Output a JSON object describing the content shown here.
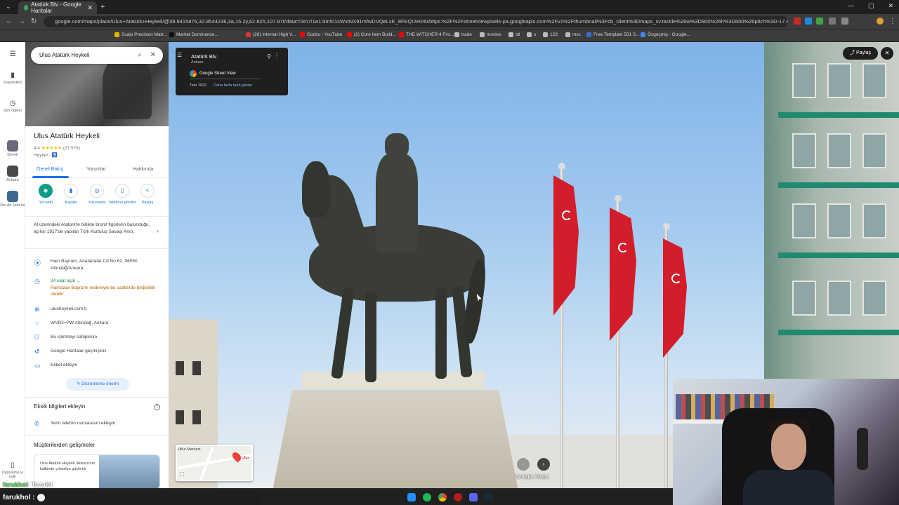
{
  "browser": {
    "tab_title": "Atatürk Blv - Google Haritalar",
    "url": "google.com/maps/place/Ulus+Atatürk+Heykeli/@39.9415876,32.8544236,3a,15.2y,62.82h,107.87t/data=!3m7!1e1!3m5!1sWvINX91mfwDVQeLxK_8FEQ!2e0!6shttps:%2F%2Fstreetviewpixels-pa.googleapis.com%2Fv1%2Fthumbnail%3Fcb_client%3Dmaps_sv.tactile%26w%3D900%26h%3D600%26pitch%3D-17.86526409588829...",
    "bookmarks": [
      "Scalp Precision Matr...",
      "Market Dominance...",
      "(28) Internal High V...",
      "Godzu - YouTube",
      "(2) Core Item Build...",
      "THE WITCHER 4 Firs...",
      "trade",
      "movies",
      "stl",
      "s",
      "123",
      "msc",
      "Free Template 551 S...",
      "Özgeçmiş - Google..."
    ]
  },
  "rail": {
    "saved": "Kaydedildi",
    "recent": "Son öğeler",
    "recent_items": [
      "Develi",
      "Ankara",
      "Rio de Janeiro"
    ],
    "app": "Uygulama yı indir"
  },
  "search": {
    "value": "Ulus Atatürk Heykeli"
  },
  "place": {
    "title": "Ulus Atatürk Heykeli",
    "rating": "4,4",
    "stars": "★★★★★",
    "reviews": "(27.576)",
    "category": "Heykel · ♿",
    "tabs": [
      "Genel Bakış",
      "Yorumlar",
      "Hakkında"
    ],
    "actions": [
      {
        "label": "Yol tarifi",
        "icon": "◆"
      },
      {
        "label": "Kaydet",
        "icon": "▮"
      },
      {
        "label": "Yakınında",
        "icon": "◎"
      },
      {
        "label": "Telefona gönder",
        "icon": "▯"
      },
      {
        "label": "Paylaş",
        "icon": "<"
      }
    ],
    "description": "At üzerindeki Atatürk'le birlikte bronz figürlerin bulunduğu, açılışı 1927'de yapılan Türk Kurtuluş Savaşı Anıtı.",
    "address": "Hacı Bayram, Anafartalar Cd No:62, 06050 Altındağ/Ankara",
    "hours_status": "24 saat açık",
    "hours_warning": "Ramazan Bayramı nedeniyle bu saatlerde değişiklik olabilir",
    "website": "ulusheykeli.com.tr",
    "plus_code": "WVR3+PW Altındağ, Ankara",
    "claim": "Bu işletmeyi sahiplenin",
    "history": "Google Haritalar geçmişiniz",
    "label": "Etiket ekleyin",
    "suggest_edit": "Düzenleme önerin",
    "missing_title": "Eksik bilgileri ekleyin",
    "add_phone": "Yerin telefon numarasını ekleyin",
    "highlights_title": "Müşterilerden gelişmeler",
    "card_text": "Ulus Atatürk Heykeli, Ankara'nın kalbinde yükselen güçlü bir"
  },
  "streetview": {
    "street": "Atatürk Blv",
    "city": "Ankara",
    "source": "Google Street View",
    "date": "Tem 2020",
    "more_dates": "Daha fazla tarih göster",
    "share": "Paylaş",
    "minimap_label": "ültür Merkezi",
    "minimap_place": "Ulus",
    "brand": "Google Maps"
  },
  "chat": {
    "line1_user": "farukhol",
    "line1_text": ": Tuzakli",
    "line2_user": "farukhol :"
  },
  "colors": {
    "accent": "#1a73e8",
    "open": "#188038",
    "flag": "#d31d2a"
  }
}
